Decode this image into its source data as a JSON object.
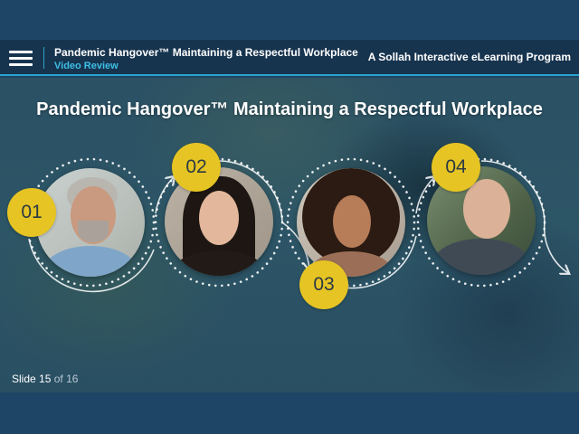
{
  "header": {
    "title": "Pandemic Hangover™ Maintaining a Respectful Workplace",
    "subtitle": "Video Review",
    "brand": "A Sollah Interactive eLearning Program",
    "menu_icon": "hamburger-menu-icon"
  },
  "stage": {
    "title": "Pandemic Hangover™ Maintaining a Respectful Workplace",
    "videos": [
      {
        "number": "01"
      },
      {
        "number": "02"
      },
      {
        "number": "03"
      },
      {
        "number": "04"
      }
    ]
  },
  "footer": {
    "slide_word": "Slide",
    "current": "15",
    "of_word": "of",
    "total": "16"
  },
  "colors": {
    "header_bg": "#17344f",
    "accent_line": "#2ba3c9",
    "subtitle": "#3cc0e6",
    "badge": "#e6c423"
  }
}
